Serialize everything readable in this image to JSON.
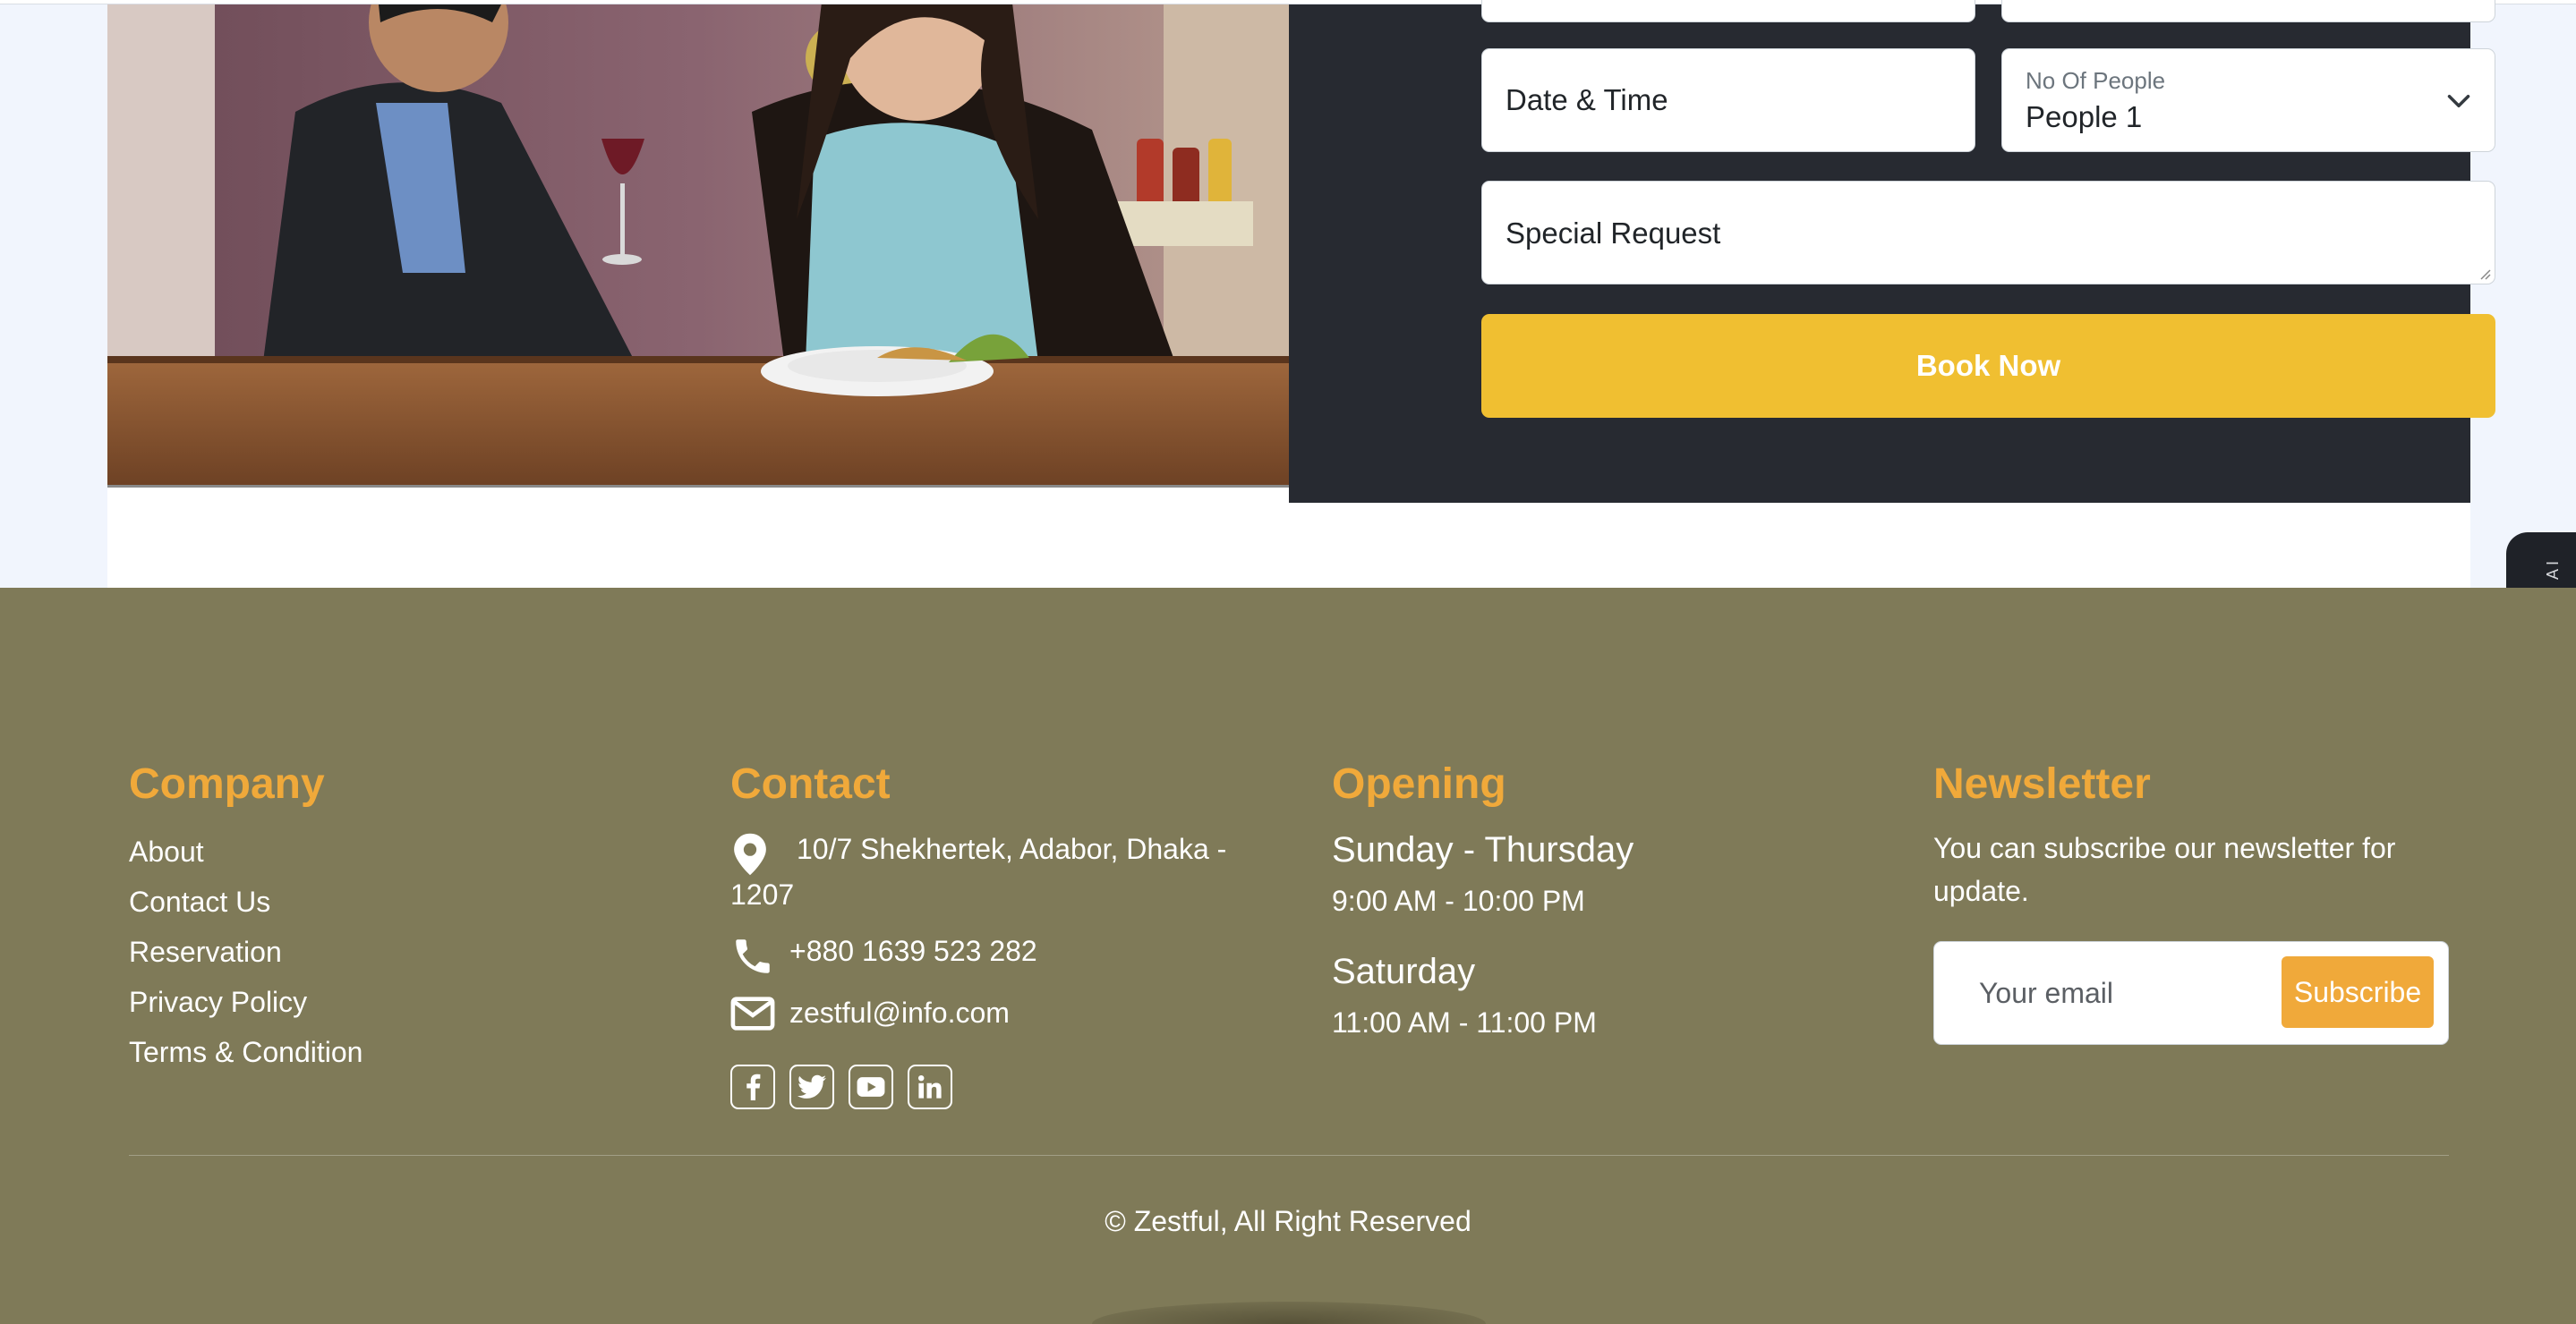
{
  "reservation": {
    "date_time_placeholder": "Date & Time",
    "people_label": "No Of People",
    "people_value": "People 1",
    "special_request_placeholder": "Special Request",
    "book_button": "Book Now"
  },
  "side_widget": {
    "label": "BLACKBOX AI"
  },
  "footer": {
    "company": {
      "heading": "Company",
      "links": [
        "About",
        "Contact Us",
        "Reservation",
        "Privacy Policy",
        "Terms & Condition"
      ]
    },
    "contact": {
      "heading": "Contact",
      "address_line1": "10/7 Shekhertek, Adabor, Dhaka -",
      "address_line2": "1207",
      "phone": "+880 1639 523 282",
      "email": "zestful@info.com",
      "socials": [
        "facebook-icon",
        "twitter-icon",
        "youtube-icon",
        "linkedin-icon"
      ]
    },
    "opening": {
      "heading": "Opening",
      "day1": "Sunday - Thursday",
      "hours1": "9:00 AM - 10:00 PM",
      "day2": "Saturday",
      "hours2": "11:00 AM - 11:00 PM"
    },
    "newsletter": {
      "heading": "Newsletter",
      "text": "You can subscribe our newsletter for update.",
      "email_placeholder": "Your email",
      "subscribe_button": "Subscribe"
    },
    "copyright": "© Zestful, All Right Reserved"
  },
  "colors": {
    "accent_yellow": "#f0bf31",
    "heading_orange": "#f0a93a",
    "footer_bg": "#7f7a58",
    "form_panel_bg": "#272a31"
  }
}
